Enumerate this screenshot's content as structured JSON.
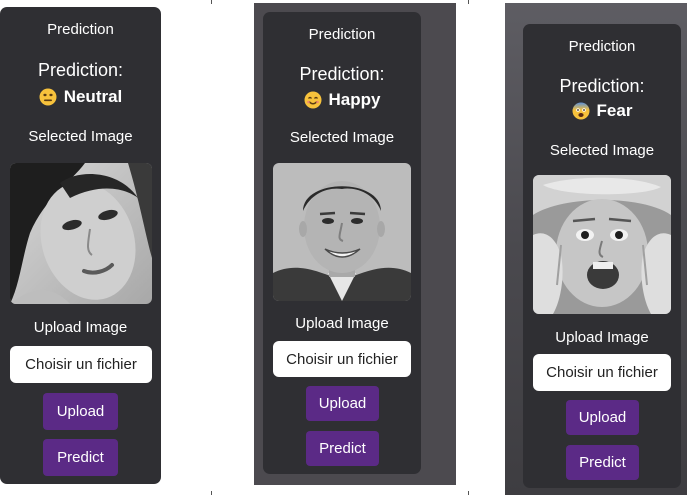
{
  "cards": [
    {
      "title": "Prediction",
      "prediction_label": "Prediction:",
      "prediction_value": "Neutral",
      "emoji_icon": "neutral-face-icon",
      "selected_image_label": "Selected Image",
      "upload_image_label": "Upload Image",
      "file_button_label": "Choisir un fichier",
      "upload_button_label": "Upload",
      "predict_button_label": "Predict"
    },
    {
      "title": "Prediction",
      "prediction_label": "Prediction:",
      "prediction_value": "Happy",
      "emoji_icon": "smiling-face-icon",
      "selected_image_label": "Selected Image",
      "upload_image_label": "Upload Image",
      "file_button_label": "Choisir un fichier",
      "upload_button_label": "Upload",
      "predict_button_label": "Predict"
    },
    {
      "title": "Prediction",
      "prediction_label": "Prediction:",
      "prediction_value": "Fear",
      "emoji_icon": "fearful-face-icon",
      "selected_image_label": "Selected Image",
      "upload_image_label": "Upload Image",
      "file_button_label": "Choisir un fichier",
      "upload_button_label": "Upload",
      "predict_button_label": "Predict"
    }
  ],
  "colors": {
    "card_background": "#2f2f33",
    "button_purple": "#5b2a86",
    "text": "#ffffff",
    "file_button_background": "#ffffff"
  }
}
